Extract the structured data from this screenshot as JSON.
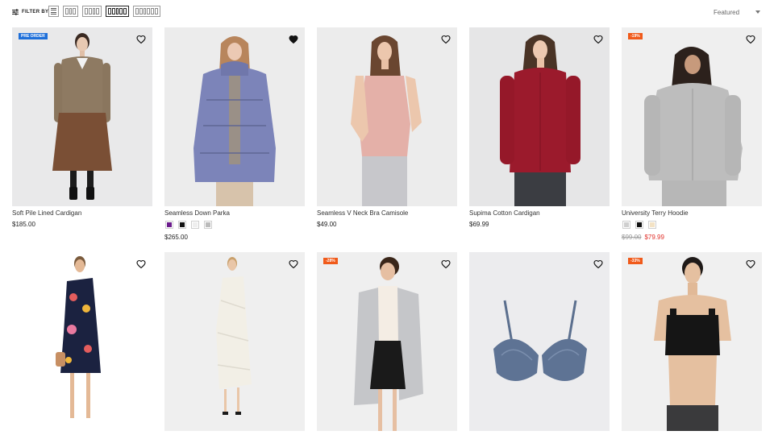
{
  "toolbar": {
    "filter_label": "FILTER BY",
    "grid_views": [
      "1 column",
      "2 columns",
      "3 columns",
      "4 columns",
      "5 columns"
    ],
    "active_view": "4 columns",
    "sort": {
      "selected": "Featured"
    }
  },
  "colors": {
    "accent_blue": "#1e6fd9",
    "accent_orange": "#f05a1a",
    "sale_red": "#e0302a"
  },
  "products": [
    {
      "name": "Soft Pile Lined Cardigan",
      "price": "$185.00",
      "badge": "PRE ORDER",
      "wishlisted": false
    },
    {
      "name": "Seamless Down Parka",
      "price": "$265.00",
      "wishlisted": true,
      "swatches": [
        "#6b1c8c",
        "#111111",
        "#eeeeee",
        "#bbbbbb"
      ]
    },
    {
      "name": "Seamless V Neck Bra Camisole",
      "price": "$49.00",
      "wishlisted": false
    },
    {
      "name": "Supima Cotton Cardigan",
      "price": "$69.99",
      "wishlisted": false
    },
    {
      "name": "University Terry Hoodie",
      "old_price": "$99.00",
      "price": "$79.99",
      "badge": "-19%",
      "wishlisted": false,
      "swatches": [
        "#cfcfcf",
        "#111111",
        "#f3e2c4"
      ]
    },
    {
      "badge": "",
      "wishlisted": false
    },
    {
      "badge": "",
      "wishlisted": false
    },
    {
      "badge": "-28%",
      "wishlisted": false
    },
    {
      "badge": "",
      "wishlisted": false
    },
    {
      "badge": "-33%",
      "wishlisted": false
    }
  ]
}
